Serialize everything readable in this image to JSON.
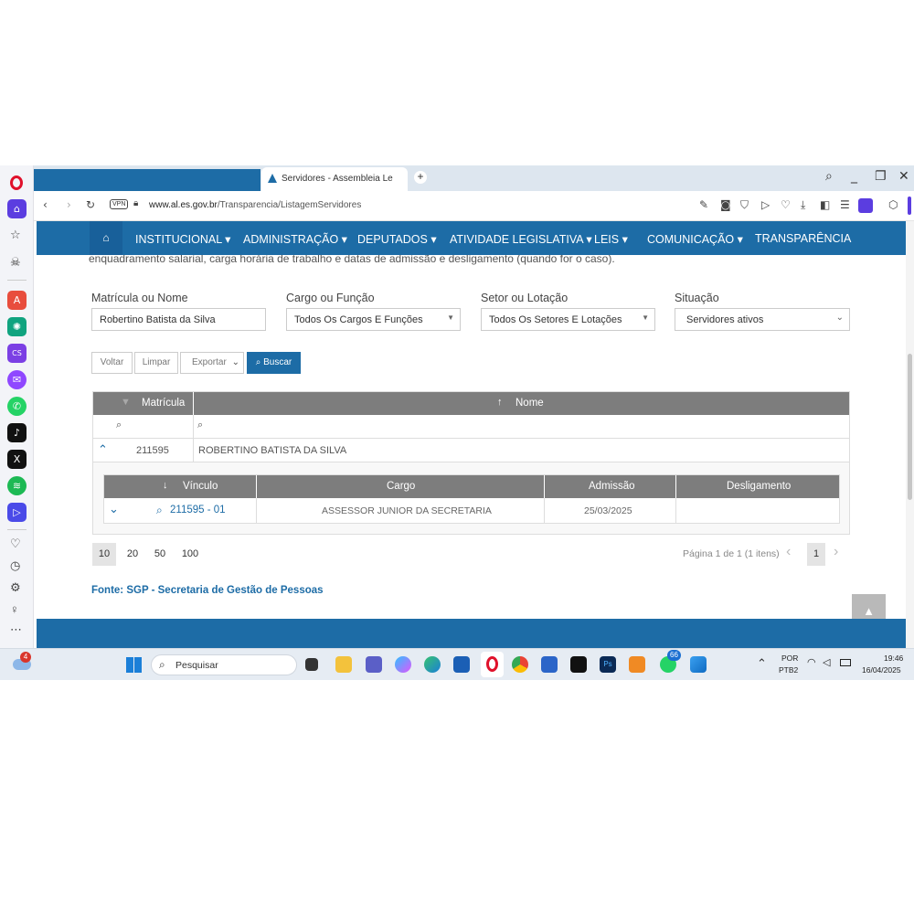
{
  "browser": {
    "tab_title": "Servidores - Assembleia Le",
    "new_tab": "+",
    "vpn_label": "VPN",
    "url_domain": "www.al.es.gov.br",
    "url_path": "/Transparencia/ListagemServidores"
  },
  "nav": {
    "items": [
      "INSTITUCIONAL ▾",
      "ADMINISTRAÇÃO ▾",
      "DEPUTADOS ▾",
      "ATIVIDADE LEGISLATIVA ▾",
      "LEIS ▾",
      "COMUNICAÇÃO ▾",
      "TRANSPARÊNCIA"
    ]
  },
  "intro_text": "enquadramento salarial, carga horária de trabalho e datas de admissão e desligamento (quando for o caso).",
  "filters": {
    "matricula_label": "Matrícula ou Nome",
    "matricula_value": "Robertino Batista da Silva",
    "cargo_label": "Cargo ou Função",
    "cargo_value": "Todos Os Cargos E Funções",
    "setor_label": "Setor ou Lotação",
    "setor_value": "Todos Os Setores E Lotações",
    "situacao_label": "Situação",
    "situacao_value": "Servidores ativos"
  },
  "buttons": {
    "voltar": "Voltar",
    "limpar": "Limpar",
    "exportar": "Exportar",
    "buscar": "Buscar"
  },
  "grid": {
    "col_matricula": "Matrícula",
    "col_nome": "Nome",
    "row": {
      "matricula": "211595",
      "nome": "ROBERTINO BATISTA DA SILVA"
    },
    "detail": {
      "col_vinculo": "Vínculo",
      "col_cargo": "Cargo",
      "col_admissao": "Admissão",
      "col_desligamento": "Desligamento",
      "vinculo": "211595 - 01",
      "cargo": "ASSESSOR JUNIOR DA SECRETARIA",
      "admissao": "25/03/2025",
      "desligamento": ""
    }
  },
  "pager": {
    "sizes": [
      "10",
      "20",
      "50",
      "100"
    ],
    "info": "Página 1 de 1 (1 itens)",
    "current": "1"
  },
  "source": "Fonte: SGP - Secretaria de Gestão de Pessoas",
  "taskbar": {
    "search_placeholder": "Pesquisar",
    "lang_top": "POR",
    "lang_bottom": "PTB2",
    "time": "19:46",
    "date": "16/04/2025",
    "weather_badge": "4",
    "whatsapp_badge": "66"
  },
  "colors": {
    "brand_blue": "#1d6ca6",
    "grid_header": "#7d7d7d",
    "opera_red": "#e0112b"
  }
}
